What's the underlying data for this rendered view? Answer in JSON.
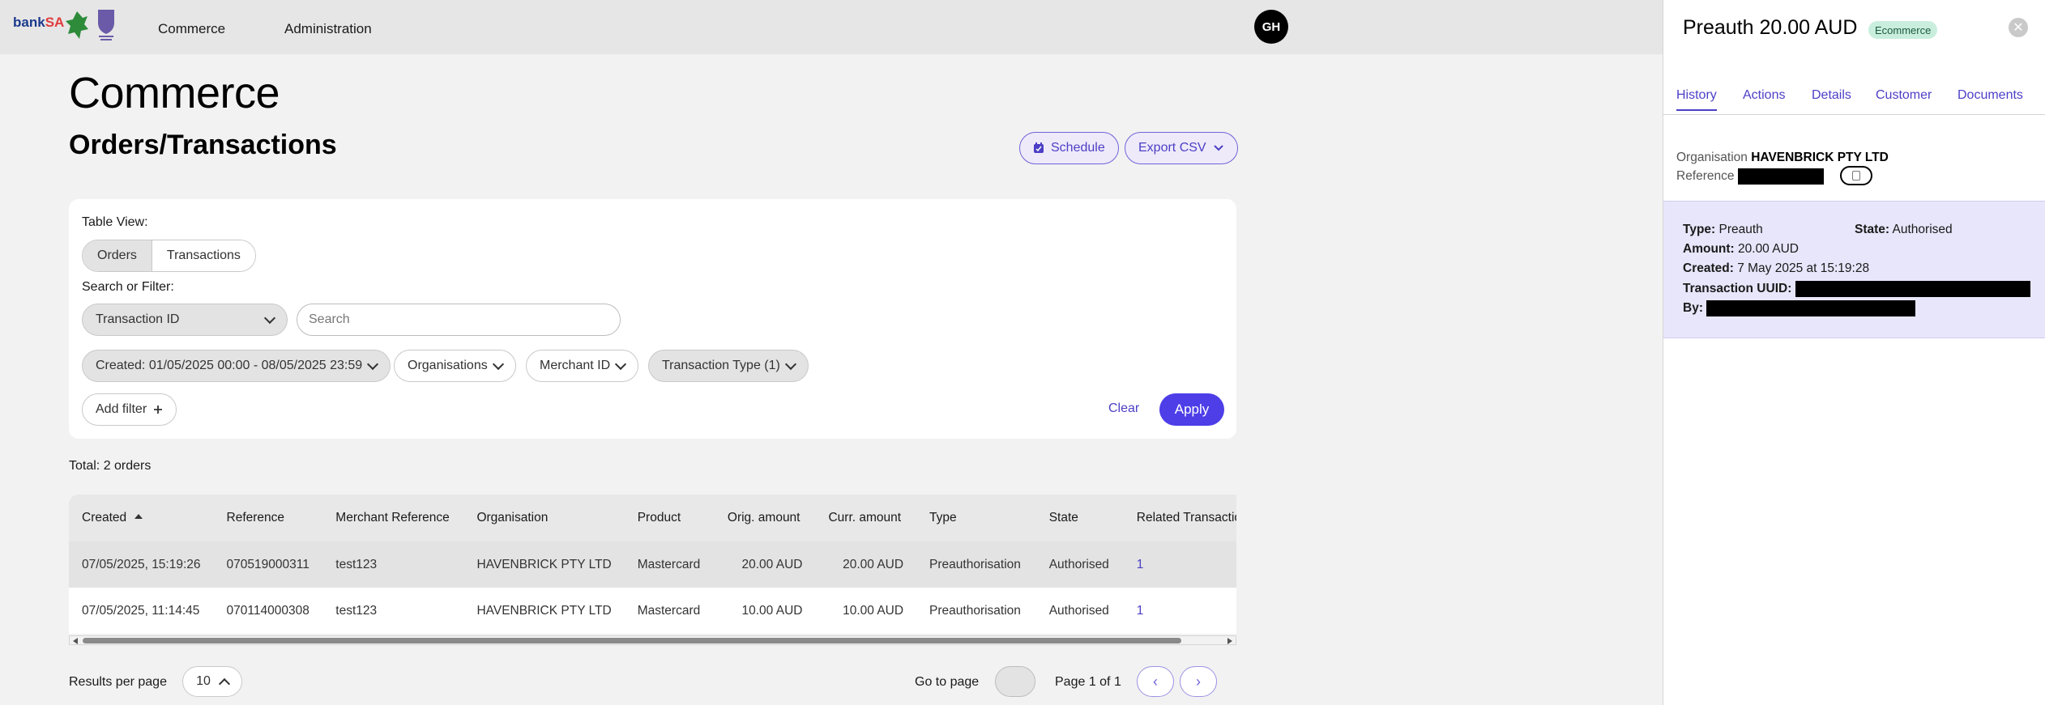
{
  "topbar": {
    "logo": {
      "bank": "bank",
      "sa": "SA"
    },
    "nav": [
      "Commerce",
      "Administration"
    ],
    "avatar_initials": "GH"
  },
  "main": {
    "page_title": "Commerce",
    "section_title": "Orders/Transactions",
    "schedule_label": "Schedule",
    "export_label": "Export CSV"
  },
  "filters": {
    "table_view_label": "Table View:",
    "views": [
      "Orders",
      "Transactions"
    ],
    "active_view": "Orders",
    "search_label": "Search or Filter:",
    "field_select": "Transaction ID",
    "search_placeholder": "Search",
    "chips": [
      {
        "label": "Created: 01/05/2025 00:00 - 08/05/2025 23:59",
        "filled": true
      },
      {
        "label": "Organisations",
        "filled": false
      },
      {
        "label": "Merchant ID",
        "filled": false
      },
      {
        "label": "Transaction Type (1)",
        "filled": true
      }
    ],
    "add_filter_label": "Add filter",
    "clear_label": "Clear",
    "apply_label": "Apply"
  },
  "total_text": "Total: 2 orders",
  "table": {
    "columns": [
      "Created",
      "Reference",
      "Merchant Reference",
      "Organisation",
      "Product",
      "Orig. amount",
      "Curr. amount",
      "Type",
      "State",
      "Related Transactions"
    ],
    "rows": [
      [
        "07/05/2025, 15:19:26",
        "070519000311",
        "test123",
        "HAVENBRICK PTY LTD",
        "Mastercard",
        "20.00 AUD",
        "20.00 AUD",
        "Preauthorisation",
        "Authorised",
        "1"
      ],
      [
        "07/05/2025, 11:14:45",
        "070114000308",
        "test123",
        "HAVENBRICK PTY LTD",
        "Mastercard",
        "10.00 AUD",
        "10.00 AUD",
        "Preauthorisation",
        "Authorised",
        "1"
      ]
    ]
  },
  "pagination": {
    "results_per_page_label": "Results per page",
    "results_per_page": "10",
    "go_to_page_label": "Go to page",
    "page_text": "Page 1 of 1",
    "prev_icon": "‹",
    "next_icon": "›"
  },
  "panel": {
    "title": "Preauth 20.00 AUD",
    "badge": "Ecommerce",
    "tabs": [
      "History",
      "Actions",
      "Details",
      "Customer",
      "Documents"
    ],
    "active_tab": "History",
    "organisation_label": "Organisation",
    "organisation_value": "HAVENBRICK PTY LTD",
    "reference_label": "Reference",
    "details": {
      "type_label": "Type:",
      "type_value": "Preauth",
      "state_label": "State:",
      "state_value": "Authorised",
      "amount_label": "Amount:",
      "amount_value": "20.00 AUD",
      "created_label": "Created:",
      "created_value": "7 May 2025 at 15:19:28",
      "uuid_label": "Transaction UUID:",
      "by_label": "By:"
    }
  },
  "colors": {
    "accent": "#4d3ee8",
    "link": "#4c3fc6",
    "badge_bg": "#c9eedd",
    "panel_card_bg": "#e8e6fb"
  }
}
